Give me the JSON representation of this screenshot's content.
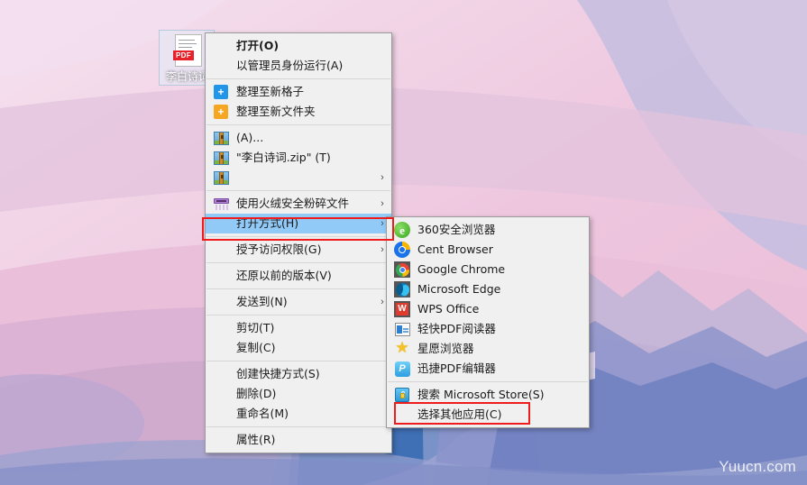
{
  "desktop": {
    "file_icon": {
      "label": "李白诗词",
      "type_badge": "PDF",
      "icon": "pdf-file-icon"
    },
    "watermark": "Yuucn.com",
    "wallpaper_colors": {
      "sky_light": "#f3dcea",
      "sky_pink": "#f0c2da",
      "lavender": "#c6bede",
      "mauve": "#d9b3d2",
      "mountain_blue": "#3f6fb5",
      "mountain_mid": "#7b8ac4",
      "mountain_light": "#a9aed6",
      "snow": "#e6dced"
    }
  },
  "context_menu": {
    "name": "file-context-menu",
    "items": [
      {
        "id": "open",
        "label": "打开(O)",
        "icon": null,
        "arrow": false,
        "bold": true,
        "selected": false,
        "separator_after": false
      },
      {
        "id": "run-as-admin",
        "label": "以管理员身份运行(A)",
        "icon": null,
        "arrow": false,
        "bold": false,
        "selected": false,
        "separator_after": true
      },
      {
        "id": "organize-new-grid",
        "label": "整理至新格子",
        "icon": "blue-plus-icon",
        "arrow": false,
        "bold": false,
        "selected": false,
        "separator_after": false
      },
      {
        "id": "organize-new-folder",
        "label": "整理至新文件夹",
        "icon": "orange-plus-icon",
        "arrow": false,
        "bold": false,
        "selected": false,
        "separator_after": true
      },
      {
        "id": "archive-a",
        "label": "(A)...",
        "icon": "zip-icon",
        "arrow": false,
        "bold": false,
        "selected": false,
        "separator_after": false
      },
      {
        "id": "archive-named",
        "label": "\"李白诗词.zip\" (T)",
        "icon": "zip-icon",
        "arrow": false,
        "bold": false,
        "selected": false,
        "separator_after": false
      },
      {
        "id": "archive-more",
        "label": "",
        "icon": "zip-icon",
        "arrow": true,
        "bold": false,
        "selected": false,
        "separator_after": true
      },
      {
        "id": "huorong-shred",
        "label": "使用火绒安全粉碎文件",
        "icon": "shredder-icon",
        "arrow": true,
        "bold": false,
        "selected": false,
        "separator_after": false
      },
      {
        "id": "open-with",
        "label": "打开方式(H)",
        "icon": null,
        "arrow": true,
        "bold": false,
        "selected": true,
        "separator_after": true
      },
      {
        "id": "grant-access",
        "label": "授予访问权限(G)",
        "icon": null,
        "arrow": true,
        "bold": false,
        "selected": false,
        "separator_after": true
      },
      {
        "id": "restore-versions",
        "label": "还原以前的版本(V)",
        "icon": null,
        "arrow": false,
        "bold": false,
        "selected": false,
        "separator_after": true
      },
      {
        "id": "send-to",
        "label": "发送到(N)",
        "icon": null,
        "arrow": true,
        "bold": false,
        "selected": false,
        "separator_after": true
      },
      {
        "id": "cut",
        "label": "剪切(T)",
        "icon": null,
        "arrow": false,
        "bold": false,
        "selected": false,
        "separator_after": false
      },
      {
        "id": "copy",
        "label": "复制(C)",
        "icon": null,
        "arrow": false,
        "bold": false,
        "selected": false,
        "separator_after": true
      },
      {
        "id": "create-shortcut",
        "label": "创建快捷方式(S)",
        "icon": null,
        "arrow": false,
        "bold": false,
        "selected": false,
        "separator_after": false
      },
      {
        "id": "delete",
        "label": "删除(D)",
        "icon": null,
        "arrow": false,
        "bold": false,
        "selected": false,
        "separator_after": false
      },
      {
        "id": "rename",
        "label": "重命名(M)",
        "icon": null,
        "arrow": false,
        "bold": false,
        "selected": false,
        "separator_after": true
      },
      {
        "id": "properties",
        "label": "属性(R)",
        "icon": null,
        "arrow": false,
        "bold": false,
        "selected": false,
        "separator_after": false
      }
    ]
  },
  "submenu": {
    "name": "open-with-submenu",
    "items": [
      {
        "id": "browser-360",
        "label": "360安全浏览器",
        "icon": "app-360-icon",
        "separator_after": false
      },
      {
        "id": "cent-browser",
        "label": "Cent Browser",
        "icon": "cent-browser-icon",
        "separator_after": false
      },
      {
        "id": "google-chrome",
        "label": "Google Chrome",
        "icon": "chrome-icon",
        "separator_after": false
      },
      {
        "id": "microsoft-edge",
        "label": "Microsoft Edge",
        "icon": "edge-icon",
        "separator_after": false
      },
      {
        "id": "wps-office",
        "label": "WPS Office",
        "icon": "wps-icon",
        "separator_after": false
      },
      {
        "id": "qingkuai-pdf",
        "label": "轻快PDF阅读器",
        "icon": "pdf-reader-icon",
        "separator_after": false
      },
      {
        "id": "xingyuan",
        "label": "星愿浏览器",
        "icon": "star-browser-icon",
        "separator_after": false
      },
      {
        "id": "xunjie-pdf",
        "label": "迅捷PDF编辑器",
        "icon": "xunjie-pdf-icon",
        "separator_after": true
      },
      {
        "id": "search-store",
        "label": "搜索 Microsoft Store(S)",
        "icon": "store-icon",
        "separator_after": false
      },
      {
        "id": "choose-other",
        "label": "选择其他应用(C)",
        "icon": null,
        "separator_after": false
      }
    ]
  },
  "annotations": {
    "color": "#ee1c1c",
    "boxes": [
      {
        "id": "open-with-highlight",
        "target": "打开方式(H)"
      },
      {
        "id": "choose-app-highlight",
        "target": "选择其他应用(C)"
      }
    ]
  },
  "glyphs": {
    "submenu_arrow": "›",
    "plus": "+",
    "star": "★",
    "letter_e": "e",
    "letter_w": "W",
    "letter_p": "P"
  }
}
